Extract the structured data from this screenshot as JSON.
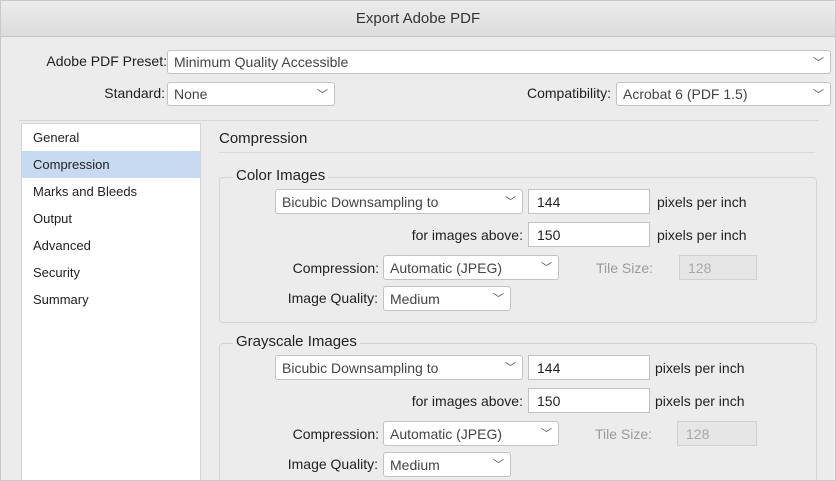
{
  "window": {
    "title": "Export Adobe PDF"
  },
  "preset": {
    "label": "Adobe PDF Preset:",
    "value": "Minimum Quality Accessible"
  },
  "standard": {
    "label": "Standard:",
    "value": "None"
  },
  "compatibility": {
    "label": "Compatibility:",
    "value": "Acrobat 6 (PDF 1.5)"
  },
  "sidebar": {
    "items": [
      {
        "label": "General"
      },
      {
        "label": "Compression"
      },
      {
        "label": "Marks and Bleeds"
      },
      {
        "label": "Output"
      },
      {
        "label": "Advanced"
      },
      {
        "label": "Security"
      },
      {
        "label": "Summary"
      }
    ],
    "selected": "Compression"
  },
  "content": {
    "heading": "Compression",
    "color_images": {
      "title": "Color Images",
      "downsampling": "Bicubic Downsampling to",
      "ppi_value": "144",
      "ppi_unit": "pixels per inch",
      "above_label": "for images above:",
      "above_value": "150",
      "above_unit": "pixels per inch",
      "compression_label": "Compression:",
      "compression_value": "Automatic (JPEG)",
      "tile_label": "Tile Size:",
      "tile_value": "128",
      "quality_label": "Image Quality:",
      "quality_value": "Medium"
    },
    "grayscale_images": {
      "title": "Grayscale Images",
      "downsampling": "Bicubic Downsampling to",
      "ppi_value": "144",
      "ppi_unit": "pixels per inch",
      "above_label": "for images above:",
      "above_value": "150",
      "above_unit": "pixels per inch",
      "compression_label": "Compression:",
      "compression_value": "Automatic (JPEG)",
      "tile_label": "Tile Size:",
      "tile_value": "128",
      "quality_label": "Image Quality:",
      "quality_value": "Medium"
    }
  },
  "colors": {
    "selection": "#c8d9f2",
    "background": "#ececec",
    "disabled_text": "#a8a8a8"
  },
  "icons": {
    "dropdown": "chevron-down-icon"
  }
}
